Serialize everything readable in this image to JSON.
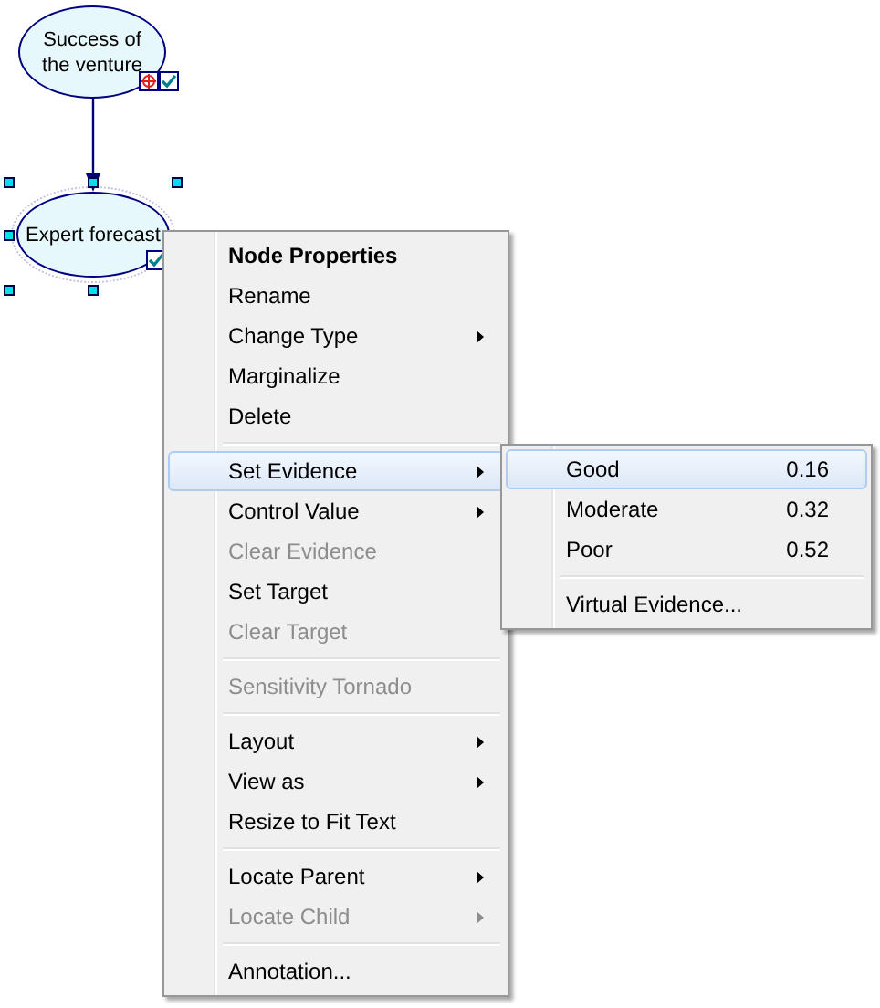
{
  "nodes": [
    {
      "label": "Success of the venture",
      "selected": false,
      "target": true
    },
    {
      "label": "Expert forecast",
      "selected": true,
      "target": false
    }
  ],
  "context_menu": {
    "items": [
      {
        "kind": "item",
        "label": "Node Properties",
        "bold": true,
        "disabled": false,
        "submenu": false,
        "selected": false
      },
      {
        "kind": "item",
        "label": "Rename",
        "bold": false,
        "disabled": false,
        "submenu": false,
        "selected": false
      },
      {
        "kind": "item",
        "label": "Change Type",
        "bold": false,
        "disabled": false,
        "submenu": true,
        "selected": false
      },
      {
        "kind": "item",
        "label": "Marginalize",
        "bold": false,
        "disabled": false,
        "submenu": false,
        "selected": false
      },
      {
        "kind": "item",
        "label": "Delete",
        "bold": false,
        "disabled": false,
        "submenu": false,
        "selected": false
      },
      {
        "kind": "separator"
      },
      {
        "kind": "item",
        "label": "Set Evidence",
        "bold": false,
        "disabled": false,
        "submenu": true,
        "selected": true
      },
      {
        "kind": "item",
        "label": "Control Value",
        "bold": false,
        "disabled": false,
        "submenu": true,
        "selected": false
      },
      {
        "kind": "item",
        "label": "Clear Evidence",
        "bold": false,
        "disabled": true,
        "submenu": false,
        "selected": false
      },
      {
        "kind": "item",
        "label": "Set Target",
        "bold": false,
        "disabled": false,
        "submenu": false,
        "selected": false
      },
      {
        "kind": "item",
        "label": "Clear Target",
        "bold": false,
        "disabled": true,
        "submenu": false,
        "selected": false
      },
      {
        "kind": "separator"
      },
      {
        "kind": "item",
        "label": "Sensitivity Tornado",
        "bold": false,
        "disabled": true,
        "submenu": false,
        "selected": false
      },
      {
        "kind": "separator"
      },
      {
        "kind": "item",
        "label": "Layout",
        "bold": false,
        "disabled": false,
        "submenu": true,
        "selected": false
      },
      {
        "kind": "item",
        "label": "View as",
        "bold": false,
        "disabled": false,
        "submenu": true,
        "selected": false
      },
      {
        "kind": "item",
        "label": "Resize to Fit Text",
        "bold": false,
        "disabled": false,
        "submenu": false,
        "selected": false
      },
      {
        "kind": "separator"
      },
      {
        "kind": "item",
        "label": "Locate Parent",
        "bold": false,
        "disabled": false,
        "submenu": true,
        "selected": false
      },
      {
        "kind": "item",
        "label": "Locate Child",
        "bold": false,
        "disabled": true,
        "submenu": true,
        "selected": false
      },
      {
        "kind": "separator"
      },
      {
        "kind": "item",
        "label": "Annotation...",
        "bold": false,
        "disabled": false,
        "submenu": false,
        "selected": false
      }
    ]
  },
  "evidence_submenu": {
    "items": [
      {
        "kind": "item",
        "label": "Good",
        "value": "0.16",
        "selected": true
      },
      {
        "kind": "item",
        "label": "Moderate",
        "value": "0.32",
        "selected": false
      },
      {
        "kind": "item",
        "label": "Poor",
        "value": "0.52",
        "selected": false
      },
      {
        "kind": "separator"
      },
      {
        "kind": "item",
        "label": "Virtual Evidence...",
        "selected": false
      }
    ]
  }
}
